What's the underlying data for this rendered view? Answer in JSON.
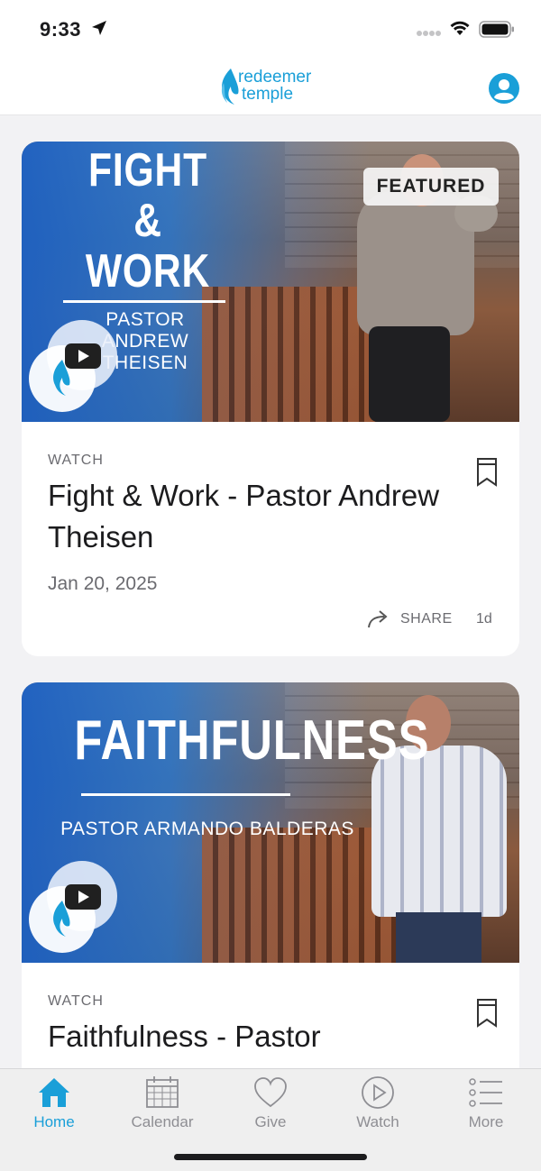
{
  "status_bar": {
    "time": "9:33"
  },
  "header": {
    "logo_line1": "redeemer",
    "logo_line2": "temple",
    "brand_color": "#1a9fd8"
  },
  "cards": [
    {
      "slide": {
        "title": "FIGHT & WORK",
        "subtitle": "PASTOR ANDREW THEISEN"
      },
      "badge": "FEATURED",
      "kicker": "WATCH",
      "title": "Fight & Work - Pastor Andrew Theisen",
      "date": "Jan 20, 2025",
      "share_label": "SHARE",
      "age": "1d"
    },
    {
      "slide": {
        "title": "FAITHFULNESS",
        "subtitle": "PASTOR ARMANDO BALDERAS"
      },
      "kicker": "WATCH",
      "title": "Faithfulness - Pastor"
    }
  ],
  "tabbar": {
    "items": [
      {
        "label": "Home",
        "icon": "home-icon",
        "active": true
      },
      {
        "label": "Calendar",
        "icon": "calendar-icon"
      },
      {
        "label": "Give",
        "icon": "heart-icon"
      },
      {
        "label": "Watch",
        "icon": "play-circle-icon"
      },
      {
        "label": "More",
        "icon": "list-icon"
      }
    ],
    "active_color": "#1a9fd8",
    "inactive_color": "#8e8e93"
  }
}
